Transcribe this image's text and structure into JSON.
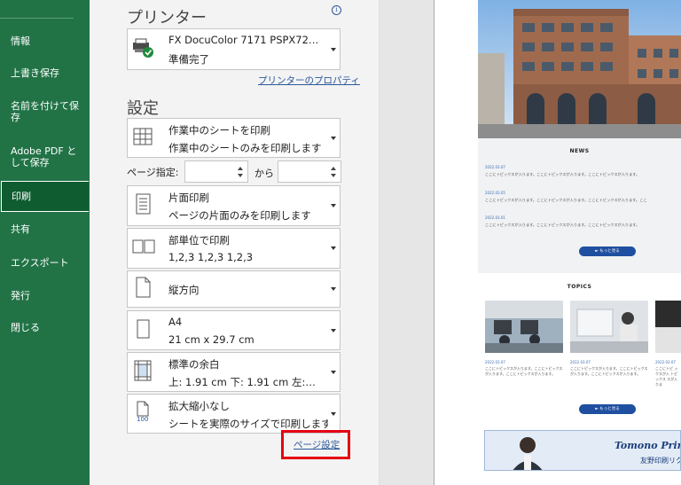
{
  "nav": {
    "items": [
      {
        "label": "情報"
      },
      {
        "label": "上書き保存"
      },
      {
        "label": "名前を付けて保存"
      },
      {
        "label": "Adobe PDF として保存"
      },
      {
        "label": "印刷"
      },
      {
        "label": "共有"
      },
      {
        "label": "エクスポート"
      },
      {
        "label": "発行"
      },
      {
        "label": "閉じる"
      }
    ],
    "active": "印刷"
  },
  "printer": {
    "section_title": "プリンター",
    "info_icon": "i",
    "name": "FX DocuColor 7171 PSPX72…",
    "status": "準備完了",
    "properties_link": "プリンターのプロパティ"
  },
  "settings": {
    "section_title": "設定",
    "scope": {
      "title": "作業中のシートを印刷",
      "desc": "作業中のシートのみを印刷します"
    },
    "pages": {
      "label": "ページ指定:",
      "from_value": "",
      "to_label": "から",
      "to_value": ""
    },
    "sides": {
      "title": "片面印刷",
      "desc": "ページの片面のみを印刷します"
    },
    "collate": {
      "title": "部単位で印刷",
      "desc": "1,2,3    1,2,3    1,2,3"
    },
    "orientation": {
      "title": "縦方向"
    },
    "paper": {
      "title": "A4",
      "desc": "21 cm x 29.7 cm"
    },
    "margins": {
      "title": "標準の余白",
      "desc": "上: 1.91 cm 下: 1.91 cm 左:…"
    },
    "scaling": {
      "title": "拡大縮小なし",
      "desc": "シートを実際のサイズで印刷します",
      "icon_text": "100"
    },
    "page_setup_link": "ページ設定"
  },
  "preview": {
    "news_heading": "NEWS",
    "news": [
      {
        "date": "2022.03.07",
        "text": "ここにトピックスが入ります。ここにトピックスが入ります。ここにトピックスが入ります。"
      },
      {
        "date": "2022.03.05",
        "text": "ここにトピックスが入ります。ここにトピックスが入ります。ここにトピックスが入ります。ここ"
      },
      {
        "date": "2022.03.01",
        "text": "ここにトピックスが入ります。ここにトピックスが入ります。ここにトピックスが入ります。"
      }
    ],
    "more_label": "► もっと見る",
    "topics_heading": "TOPICS",
    "topics": [
      {
        "date": "2022.03.07",
        "text": "ここにトピックスが入ります。ここにトピックスが入ります。ここにトピックスが入ります。"
      },
      {
        "date": "2022.03.07",
        "text": "ここにトピックスが入ります。ここにトピックスが入ります。ここにトピックスが入ります。"
      },
      {
        "date": "2022.03.07",
        "text": "ここにトピ ックスが入 トピックス スが入りま"
      }
    ],
    "more_label_2": "► もっと見る",
    "banner_title": "Tomono Printin",
    "banner_sub": "友野印刷リク"
  },
  "colors": {
    "nav_bg": "#217346",
    "nav_active": "#0e5c2f",
    "link": "#2b579a",
    "highlight_box": "#e60012"
  }
}
